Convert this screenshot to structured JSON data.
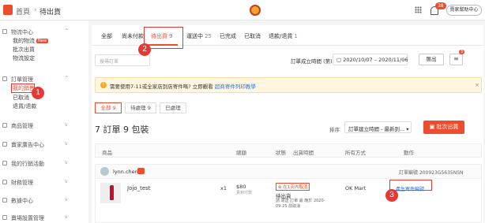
{
  "topbar": {
    "home_label": "首頁",
    "separator": "›",
    "current": "待出貨",
    "notification_count": "38",
    "help_label": "賣家幫助中心"
  },
  "sidebar": {
    "sections": [
      {
        "title": "物流中心",
        "items": [
          {
            "label": "我的物流",
            "badge": "New"
          },
          {
            "label": "批次出貨"
          },
          {
            "label": "物流設定"
          }
        ]
      },
      {
        "title": "訂單管理",
        "items": [
          {
            "label": "我的銷售"
          },
          {
            "label": "已取消"
          },
          {
            "label": "退貨/退款"
          }
        ]
      },
      {
        "title": "商品管理"
      },
      {
        "title": "賣家廣告中心"
      },
      {
        "title": "我的行銷活動"
      },
      {
        "title": "財務管理"
      },
      {
        "title": "數據中心"
      },
      {
        "title": "賣場設置管理"
      }
    ]
  },
  "tabs": [
    {
      "label": "全部",
      "count": ""
    },
    {
      "label": "尚未付款",
      "count": ""
    },
    {
      "label": "待出貨",
      "count": "9"
    },
    {
      "label": "運送中",
      "count": "25"
    },
    {
      "label": "已完成",
      "count": ""
    },
    {
      "label": "已取消",
      "count": ""
    },
    {
      "label": "退款/退貨",
      "count": "1"
    }
  ],
  "filters": {
    "search_placeholder": "搜尋訂單",
    "date_label": "訂單成立時間 (第)",
    "date_range": "2020/10/07 – 2020/11/06",
    "export_label": "匯出",
    "list_badge": "3"
  },
  "notice": {
    "text": "需要使用7-11或全家店到店寄件嗎? 立即觀看",
    "link": "超商寄件列印教學"
  },
  "subtabs": [
    {
      "label": "全部",
      "count": "9"
    },
    {
      "label": "待處理",
      "count": "9"
    },
    {
      "label": "已處理",
      "count": ""
    }
  ],
  "summary": {
    "title": "7 訂單 9 包裝",
    "sort_label": "排序",
    "sort_value": "訂單建立時間 - 最新到...",
    "batch_ship": "批次出貨"
  },
  "table": {
    "headers": [
      "商品",
      "總額",
      "狀態",
      "出貨時間",
      "所有方式",
      "動作"
    ]
  },
  "order": {
    "buyer": "lynn.chen",
    "order_no": "訂單編號 200923G5635NSN",
    "product": "Jojo_test",
    "qty": "x1",
    "price": "$80",
    "price_note": "貨到付款",
    "tag": "在1天內取消",
    "status": "待出貨",
    "status_note": "請 運送 訂單 最 晚於 2020-09-25 前取消",
    "carrier": "OK Mart",
    "action": "產生寄件編號"
  },
  "annotations": [
    "1",
    "2",
    "3"
  ],
  "colors": {
    "brand": "#ee4d2d",
    "annotation": "#e53935",
    "link": "#2673dd"
  }
}
